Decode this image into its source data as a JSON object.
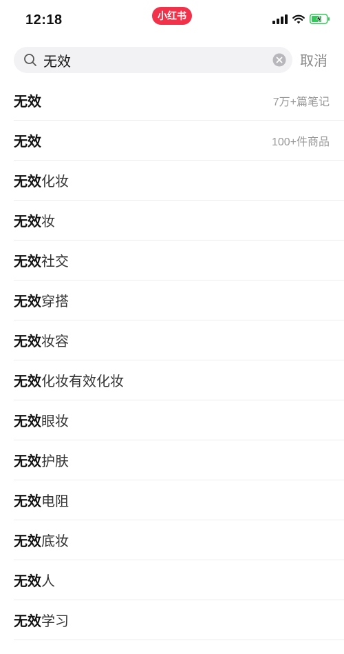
{
  "status_bar": {
    "time": "12:18",
    "app_badge": "小红书"
  },
  "search": {
    "query": "无效",
    "cancel_label": "取消"
  },
  "suggestions": [
    {
      "highlight": "无效",
      "rest": "",
      "meta": "7万+篇笔记"
    },
    {
      "highlight": "无效",
      "rest": "",
      "meta": "100+件商品"
    },
    {
      "highlight": "无效",
      "rest": "化妆",
      "meta": ""
    },
    {
      "highlight": "无效",
      "rest": "妆",
      "meta": ""
    },
    {
      "highlight": "无效",
      "rest": "社交",
      "meta": ""
    },
    {
      "highlight": "无效",
      "rest": "穿搭",
      "meta": ""
    },
    {
      "highlight": "无效",
      "rest": "妆容",
      "meta": ""
    },
    {
      "highlight": "无效",
      "rest": "化妆有效化妆",
      "meta": ""
    },
    {
      "highlight": "无效",
      "rest": "眼妆",
      "meta": ""
    },
    {
      "highlight": "无效",
      "rest": "护肤",
      "meta": ""
    },
    {
      "highlight": "无效",
      "rest": "电阻",
      "meta": ""
    },
    {
      "highlight": "无效",
      "rest": "底妆",
      "meta": ""
    },
    {
      "highlight": "无效",
      "rest": "人",
      "meta": ""
    },
    {
      "highlight": "无效",
      "rest": "学习",
      "meta": ""
    }
  ],
  "colors": {
    "brand": "#f0324a",
    "battery": "#34c759",
    "search_bg": "#f2f2f4",
    "muted": "#999999"
  },
  "icons": {
    "signal": "signal-icon",
    "wifi": "wifi-icon",
    "battery": "battery-charging-icon",
    "search": "search-icon",
    "clear": "clear-icon"
  }
}
